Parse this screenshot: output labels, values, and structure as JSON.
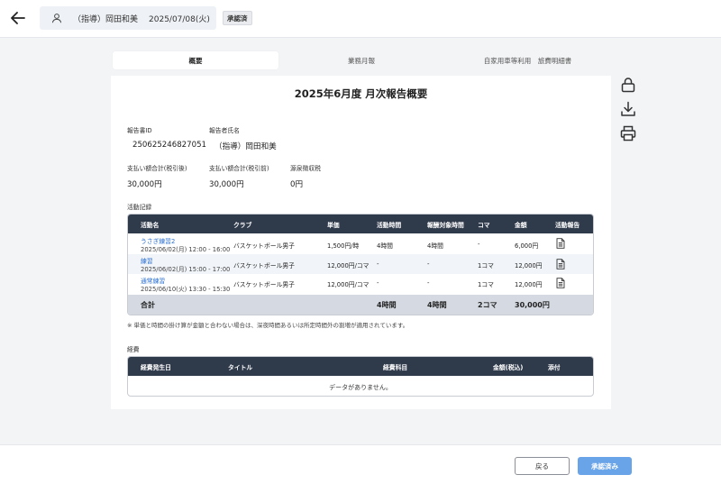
{
  "header": {
    "user_name": "（指導）岡田和美",
    "date": "2025/07/08(火)",
    "status": "承認済"
  },
  "tabs": [
    {
      "label": "概要",
      "active": true
    },
    {
      "label": "業務月報",
      "active": false
    },
    {
      "label": "自家用車等利用　旅費明細書",
      "active": false
    }
  ],
  "report": {
    "title": "2025年6月度 月次報告概要",
    "id_label": "報告書ID",
    "id_value": "250625246827051",
    "reporter_label": "報告者氏名",
    "reporter_value": "（指導）岡田和美",
    "pay_after_tax_label": "支払い額合計(税引後)",
    "pay_after_tax_value": "30,000円",
    "pay_before_tax_label": "支払い額合計(税引前)",
    "pay_before_tax_value": "30,000円",
    "withholding_label": "源泉徴収税",
    "withholding_value": "0円"
  },
  "activity": {
    "section_label": "活動記録",
    "headers": [
      "活動名",
      "クラブ",
      "単価",
      "活動時間",
      "報酬対象時間",
      "コマ",
      "金額",
      "活動報告"
    ],
    "rows": [
      {
        "name": "うさぎ練習2",
        "datetime": "2025/06/02(月) 12:00 - 16:00",
        "club": "バスケットボール男子",
        "unit_price": "1,500円/時",
        "activity_time": "4時間",
        "paid_time": "4時間",
        "koma": "-",
        "amount": "6,000円"
      },
      {
        "name": "練習",
        "datetime": "2025/06/02(月) 15:00 - 17:00",
        "club": "バスケットボール男子",
        "unit_price": "12,000円/コマ",
        "activity_time": "-",
        "paid_time": "-",
        "koma": "1コマ",
        "amount": "12,000円"
      },
      {
        "name": "通常練習",
        "datetime": "2025/06/10(火) 13:30 - 15:30",
        "club": "バスケットボール男子",
        "unit_price": "12,000円/コマ",
        "activity_time": "-",
        "paid_time": "-",
        "koma": "1コマ",
        "amount": "12,000円"
      }
    ],
    "total": {
      "label": "合計",
      "activity_time": "4時間",
      "paid_time": "4時間",
      "koma": "2コマ",
      "amount": "30,000円"
    },
    "note": "※ 単価と時間の掛け算が金額と合わない場合は、深夜時間あるいは所定時間外の割増が適用されています。"
  },
  "expenses": {
    "section_label": "経費",
    "headers": [
      "経費発生日",
      "タイトル",
      "経費科目",
      "金額(税込)",
      "添付"
    ],
    "empty_message": "データがありません。"
  },
  "side_icons": [
    "lock-icon",
    "download-icon",
    "print-icon"
  ],
  "footer": {
    "back_label": "戻る",
    "approved_label": "承認済み"
  },
  "colors": {
    "table_header": "#2f3a4b",
    "link": "#2a6fd1",
    "primary_button": "#6aa4e8",
    "total_row": "#d5dae2"
  }
}
